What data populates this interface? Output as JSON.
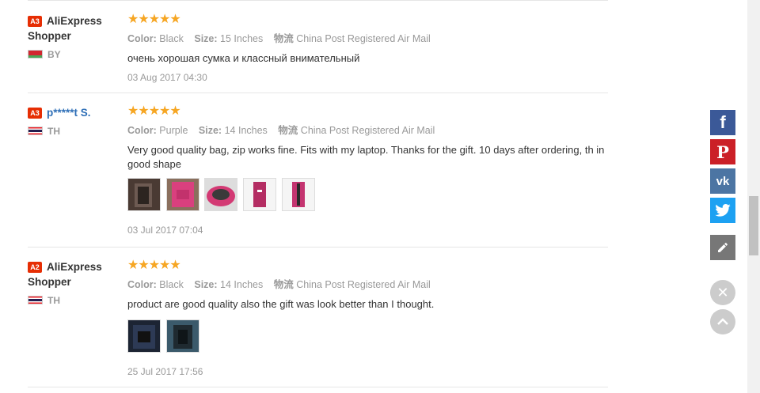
{
  "reviews": [
    {
      "level": "A3",
      "user": "AliExpress Shopper",
      "country": "BY",
      "stars": "★★★★★",
      "color_label": "Color:",
      "color": "Black",
      "size_label": "Size:",
      "size": "15 Inches",
      "logistics_label": "物流",
      "logistics": "China Post Registered Air Mail",
      "text": "очень хорошая сумка и классный внимательный",
      "date": "03 Aug 2017 04:30"
    },
    {
      "level": "A3",
      "user": "p*****t S.",
      "country": "TH",
      "stars": "★★★★★",
      "color_label": "Color:",
      "color": "Purple",
      "size_label": "Size:",
      "size": "14 Inches",
      "logistics_label": "物流",
      "logistics": "China Post Registered Air Mail",
      "text": "Very good quality bag, zip works fine. Fits with my laptop. Thanks for the gift. 10 days after ordering, th in good shape",
      "date": "03 Jul 2017 07:04"
    },
    {
      "level": "A2",
      "user": "AliExpress Shopper",
      "country": "TH",
      "stars": "★★★★★",
      "color_label": "Color:",
      "color": "Black",
      "size_label": "Size:",
      "size": "14 Inches",
      "logistics_label": "物流",
      "logistics": "China Post Registered Air Mail",
      "text": "product are good quality also the gift was look better than I thought.",
      "date": "25 Jul 2017 17:56"
    }
  ],
  "share": {
    "facebook_icon": "facebook-icon",
    "pinterest_icon": "pinterest-icon",
    "vk_icon": "vk-icon",
    "twitter_icon": "twitter-icon",
    "edit_icon": "pencil-icon",
    "close_icon": "close-icon",
    "top_icon": "chevron-up-icon"
  },
  "colors": {
    "star": "#f6a623",
    "level_badge": "#e62e04",
    "facebook": "#3b5998",
    "pinterest": "#cb2027",
    "vk": "#4c75a3",
    "twitter": "#1da1f2"
  }
}
